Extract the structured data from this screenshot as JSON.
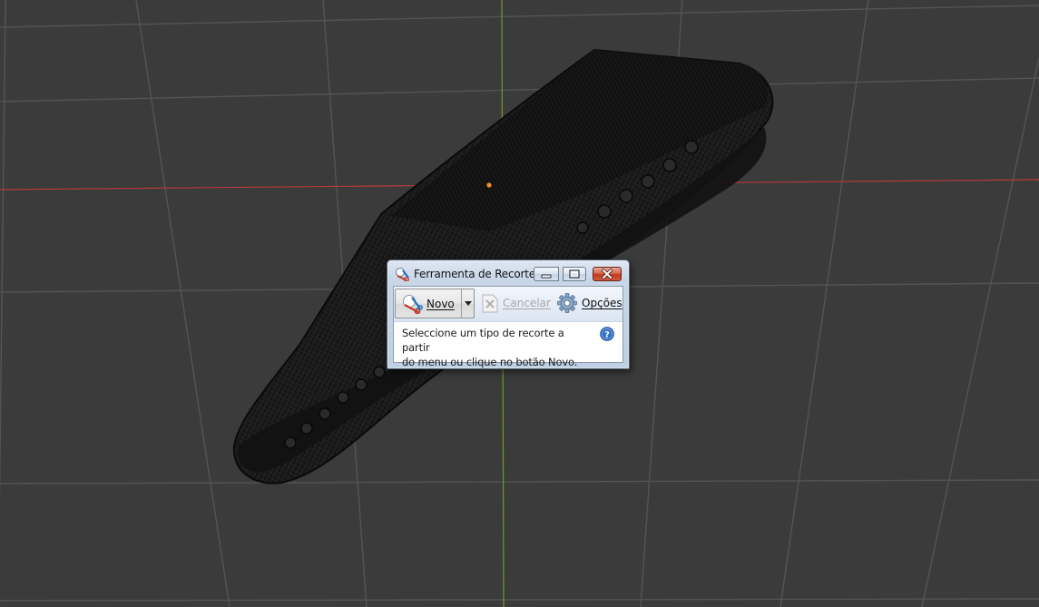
{
  "viewport": {
    "background": "#3b3b3b",
    "grid_color": "#545454",
    "x_axis_color": "#b8393d",
    "y_axis_color": "#6f9a2b",
    "origin_color": "#f0912a",
    "mesh_color": "#0f0f0f"
  },
  "snipping_tool": {
    "title": "Ferramenta de Recorte",
    "toolbar": {
      "new_label": "Novo",
      "cancel_label": "Cancelar",
      "options_label": "Opções"
    },
    "message_line1": "Seleccione um tipo de recorte a partir",
    "message_line2": "do menu ou clique no botão Novo.",
    "icons": {
      "app": "snipping-tool-icon",
      "new": "scissors-icon",
      "dropdown": "chevron-down-icon",
      "cancel": "cancel-document-icon",
      "options": "gear-icon",
      "help": "help-icon",
      "minimize": "minimize-icon",
      "maximize": "maximize-icon",
      "close": "close-icon"
    }
  }
}
